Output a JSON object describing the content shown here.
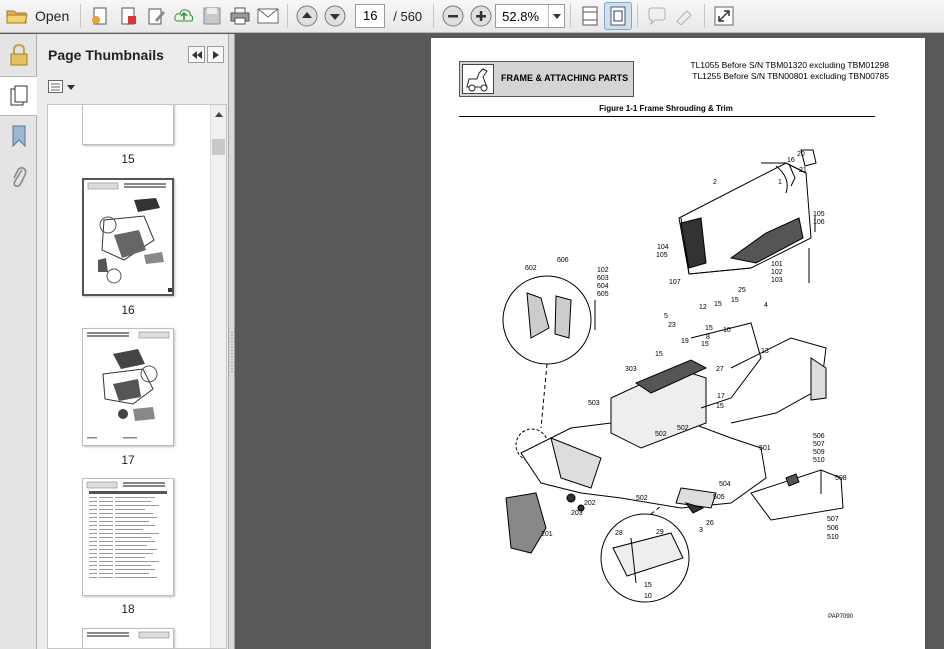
{
  "toolbar": {
    "open_label": "Open",
    "current_page": "16",
    "total_pages": "/ 560",
    "zoom": "52.8%"
  },
  "sidebar": {
    "title": "Page Thumbnails",
    "thumbnails": [
      {
        "label": "15"
      },
      {
        "label": "16"
      },
      {
        "label": "17"
      },
      {
        "label": "18"
      }
    ]
  },
  "document": {
    "section_title": "FRAME & ATTACHING PARTS",
    "model_line_1": "TL1055 Before S/N TBM01320 excluding TBM01298",
    "model_line_2": "TL1255 Before S/N TBN00801 excluding TBN00785",
    "figure_title": "Figure 1-1 Frame Shrouding & Trim",
    "part_code": "PAP7090",
    "callouts": [
      "2",
      "16",
      "20",
      "1",
      "21",
      "105",
      "106",
      "104",
      "105",
      "107",
      "101",
      "102",
      "103",
      "606",
      "602",
      "102",
      "603",
      "604",
      "605",
      "25",
      "15",
      "4",
      "5",
      "12",
      "15",
      "23",
      "15",
      "8",
      "10",
      "19",
      "15",
      "15",
      "13",
      "303",
      "27",
      "17",
      "15",
      "503",
      "502",
      "502",
      "501",
      "506",
      "507",
      "509",
      "510",
      "508",
      "504",
      "505",
      "502",
      "26",
      "3",
      "202",
      "203",
      "201",
      "507",
      "506",
      "510",
      "28",
      "29",
      "15",
      "10"
    ]
  }
}
